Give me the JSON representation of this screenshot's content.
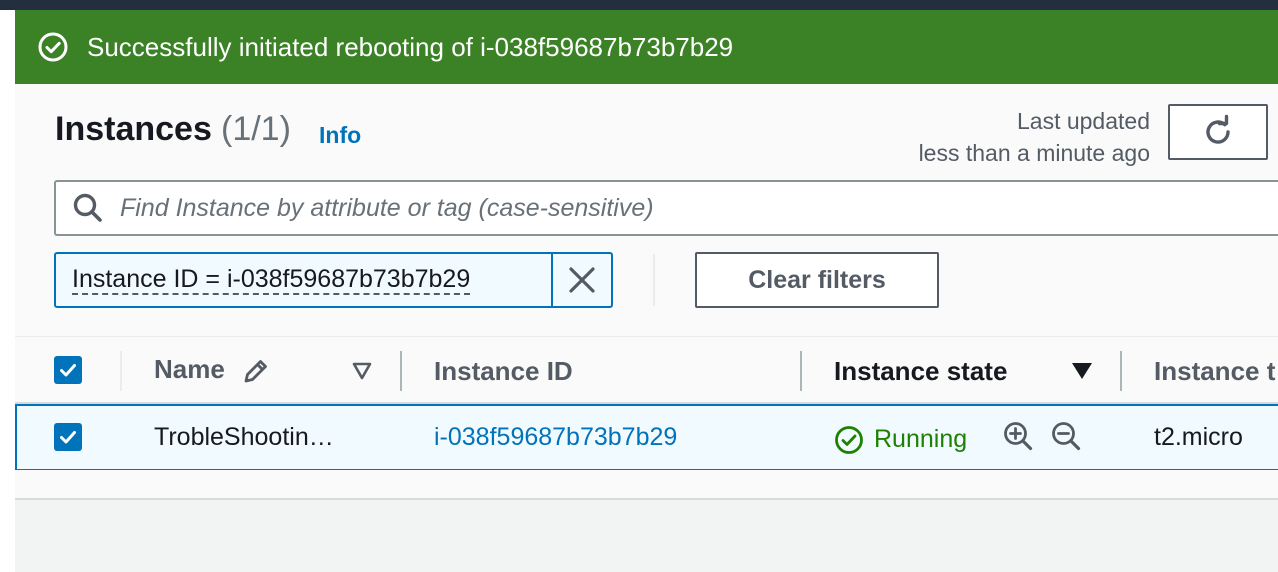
{
  "flash": {
    "message": "Successfully initiated rebooting of i-038f59687b73b7b29",
    "icon": "success-check-icon",
    "color": "#3b8125"
  },
  "header": {
    "title": "Instances",
    "count": "(1/1)",
    "info_link": "Info",
    "last_updated_label": "Last updated",
    "last_updated_value": "less than a minute ago"
  },
  "search": {
    "placeholder": "Find Instance by attribute or tag (case-sensitive)"
  },
  "filter": {
    "token": "Instance ID = i-038f59687b73b7b29",
    "clear_label": "Clear filters"
  },
  "table": {
    "columns": [
      "Name",
      "Instance ID",
      "Instance state",
      "Instance t"
    ],
    "rows": [
      {
        "selected": true,
        "name": "TrobleShootin…",
        "instance_id": "i-038f59687b73b7b29",
        "state": "Running",
        "instance_type": "t2.micro"
      }
    ]
  },
  "colors": {
    "link": "#0073bb",
    "success": "#1d8102",
    "header_bar": "#232f3e"
  }
}
